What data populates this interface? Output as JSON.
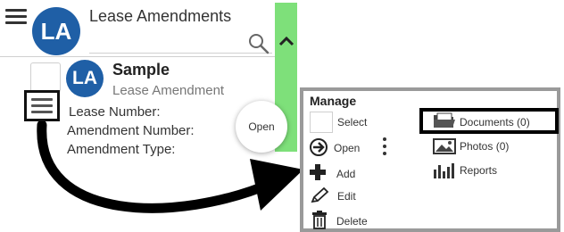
{
  "header": {
    "avatar_initials": "LA",
    "title": "Lease Amendments"
  },
  "list_item": {
    "avatar_initials": "LA",
    "title": "Sample",
    "subtitle": "Lease Amendment",
    "fields": [
      "Lease Number:",
      "Amendment Number:",
      "Amendment Type:"
    ],
    "open_button": "Open"
  },
  "manage_menu": {
    "title": "Manage",
    "actions": {
      "select": "Select",
      "open": "Open",
      "add": "Add",
      "edit": "Edit",
      "delete": "Delete"
    },
    "links": {
      "documents": "Documents (0)",
      "photos": "Photos (0)",
      "reports": "Reports"
    }
  },
  "colors": {
    "avatar": "#1f5fa6",
    "green_bar": "#7ee07a",
    "panel_border": "#9a9a9a"
  }
}
